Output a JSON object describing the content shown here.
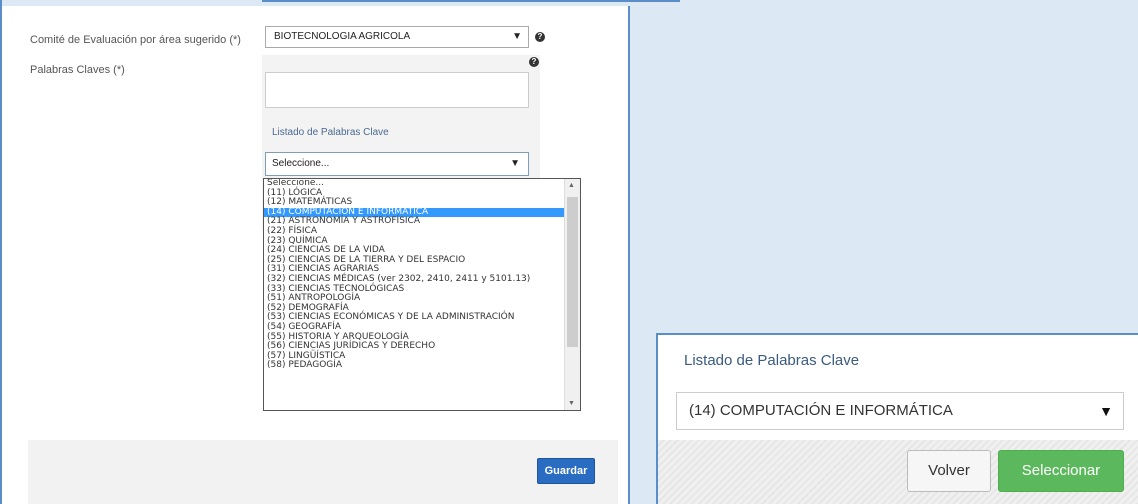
{
  "form": {
    "committee_label": "Comité de Evaluación por área sugerido (*)",
    "committee_value": "BIOTECNOLOGIA AGRICOLA",
    "keywords_label": "Palabras Claves (*)",
    "help_glyph": "?",
    "keyword_list_title": "Listado de Palabras Clave",
    "keyword_select_value": "Seleccione...",
    "save_label": "Guardar"
  },
  "dropdown": {
    "options": [
      "Seleccione...",
      "(11) LÓGICA",
      "(12) MATEMÁTICAS",
      "(14) COMPUTACIÓN E INFORMÁTICA",
      "(21) ASTRONOMÍA Y ASTROFÍSICA",
      "(22) FÍSICA",
      "(23) QUÍMICA",
      "(24) CIENCIAS DE LA VIDA",
      "(25) CIENCIAS DE LA TIERRA Y DEL ESPACIO",
      "(31) CIENCIAS AGRARIAS",
      "(32) CIENCIAS MÉDICAS (ver 2302, 2410, 2411 y 5101.13)",
      "(33) CIENCIAS TECNOLÓGICAS",
      "(51) ANTROPOLOGÍA",
      "(52) DEMOGRAFÍA",
      "(53) CIENCIAS ECONÓMICAS Y DE LA ADMINISTRACIÓN",
      "(54) GEOGRAFÍA",
      "(55) HISTORIA Y ARQUEOLOGÍA",
      "(56) CIENCIAS JURÍDICAS Y DERECHO",
      "(57) LINGÜÍSTICA",
      "(58) PEDAGOGÍA"
    ],
    "selected_index": 3
  },
  "zoom_panel": {
    "title": "Listado de Palabras Clave",
    "selected_value": "(14) COMPUTACIÓN E INFORMÁTICA",
    "back_label": "Volver",
    "select_label": "Seleccionar"
  },
  "colors": {
    "accent_blue": "#2a6cc2",
    "success_green": "#5cb85c",
    "selection_blue": "#3399ff",
    "frame_blue": "#5b8ec9"
  }
}
